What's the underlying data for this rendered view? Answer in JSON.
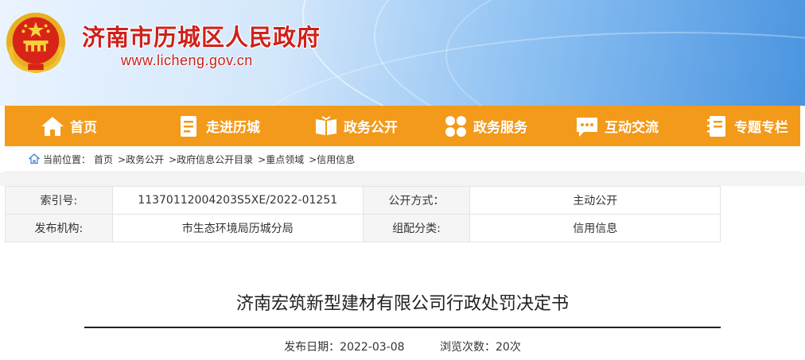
{
  "header": {
    "site_title": "济南市历城区人民政府",
    "site_url": "www.licheng.gov.cn",
    "colors": {
      "title_red": "#d0201b",
      "banner_blue": "#4a94e0"
    }
  },
  "nav": {
    "bg_color": "#f39a1a",
    "items": [
      {
        "label": "首页",
        "icon": "home-icon"
      },
      {
        "label": "走进历城",
        "icon": "document-icon"
      },
      {
        "label": "政务公开",
        "icon": "open-book-icon"
      },
      {
        "label": "政务服务",
        "icon": "grid-dots-icon"
      },
      {
        "label": "互动交流",
        "icon": "chat-icon"
      },
      {
        "label": "专题专栏",
        "icon": "notebook-icon"
      }
    ]
  },
  "breadcrumb": {
    "prefix": "当前位置：",
    "items": [
      "首页",
      ">政务公开",
      ">政府信息公开目录",
      ">重点领域",
      ">信用信息"
    ]
  },
  "meta": {
    "rows": [
      [
        "索引号:",
        "11370112004203S5XE/2022-01251",
        "公开方式：",
        "主动公开"
      ],
      [
        "发布机构:",
        "市生态环境局历城分局",
        "组配分类:",
        "信用信息"
      ]
    ]
  },
  "article": {
    "title": "济南宏筑新型建材有限公司行政处罚决定书",
    "publish_date": "发布日期：2022-03-08",
    "view_count": "浏览次数：20次"
  }
}
